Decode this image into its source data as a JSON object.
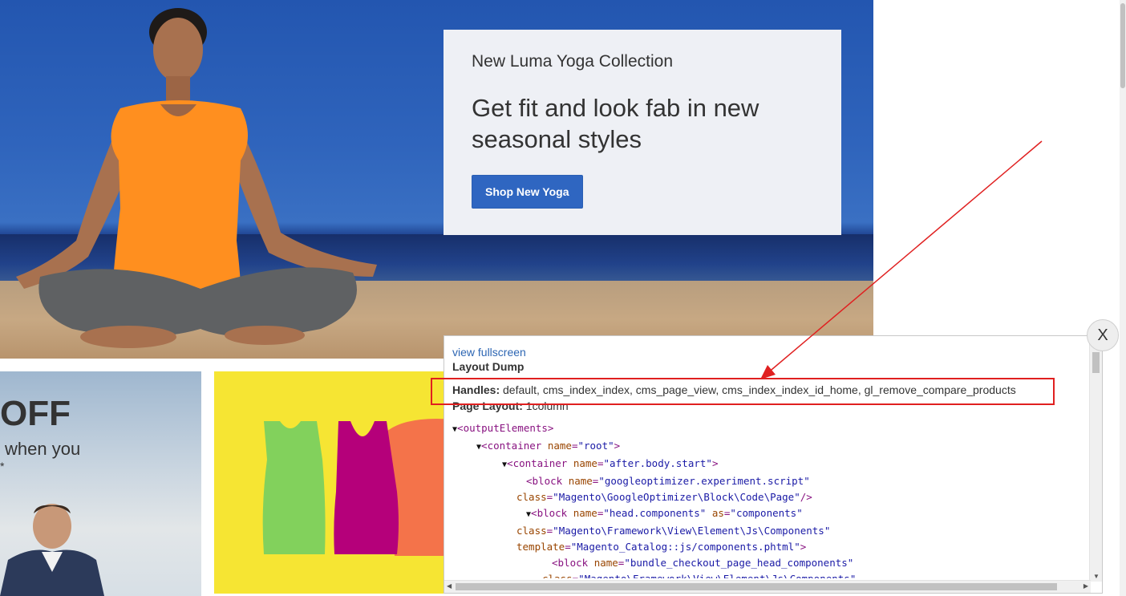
{
  "hero": {
    "kicker": "New Luma Yoga Collection",
    "title": "Get fit and look fab in new seasonal styles",
    "button_label": "Shop New Yoga"
  },
  "tiles": {
    "left_big": "OFF",
    "left_sub": "when you",
    "left_star": "*"
  },
  "dump": {
    "view_fullscreen": "view fullscreen",
    "title": "Layout Dump",
    "handles_label": "Handles:",
    "handles_value": "default, cms_index_index, cms_page_view, cms_index_index_id_home, gl_remove_compare_products",
    "page_layout_label": "Page Layout:",
    "page_layout_value": "1column",
    "code_lines": [
      {
        "tri": "▼",
        "parts": [
          [
            "p",
            "<"
          ],
          [
            "tag",
            "outputElements"
          ],
          [
            "p",
            ">"
          ]
        ]
      },
      {
        "tri": "▼",
        "parts": [
          [
            "p",
            "<"
          ],
          [
            "tag",
            "container "
          ],
          [
            "an",
            "name"
          ],
          [
            "p",
            "="
          ],
          [
            "av",
            "\"root\""
          ],
          [
            "p",
            ">"
          ]
        ]
      },
      {
        "tri": "▼",
        "parts": [
          [
            "p",
            "<"
          ],
          [
            "tag",
            "container "
          ],
          [
            "an",
            "name"
          ],
          [
            "p",
            "="
          ],
          [
            "av",
            "\"after.body.start\""
          ],
          [
            "p",
            ">"
          ]
        ]
      },
      {
        "tri": "",
        "parts": [
          [
            "p",
            "<"
          ],
          [
            "tag",
            "block "
          ],
          [
            "an",
            "name"
          ],
          [
            "p",
            "="
          ],
          [
            "av",
            "\"googleoptimizer.experiment.script\""
          ]
        ]
      },
      {
        "tri": "",
        "parts": [
          [
            "an",
            "class"
          ],
          [
            "p",
            "="
          ],
          [
            "av",
            "\"Magento\\GoogleOptimizer\\Block\\Code\\Page\""
          ],
          [
            "p",
            "/>"
          ]
        ]
      },
      {
        "tri": "▼",
        "parts": [
          [
            "p",
            "<"
          ],
          [
            "tag",
            "block "
          ],
          [
            "an",
            "name"
          ],
          [
            "p",
            "="
          ],
          [
            "av",
            "\"head.components\" "
          ],
          [
            "an",
            "as"
          ],
          [
            "p",
            "="
          ],
          [
            "av",
            "\"components\""
          ]
        ]
      },
      {
        "tri": "",
        "parts": [
          [
            "an",
            "class"
          ],
          [
            "p",
            "="
          ],
          [
            "av",
            "\"Magento\\Framework\\View\\Element\\Js\\Components\""
          ]
        ]
      },
      {
        "tri": "",
        "parts": [
          [
            "an",
            "template"
          ],
          [
            "p",
            "="
          ],
          [
            "av",
            "\"Magento_Catalog::js/components.phtml\""
          ],
          [
            "p",
            ">"
          ]
        ]
      },
      {
        "tri": "",
        "parts": [
          [
            "p",
            "<"
          ],
          [
            "tag",
            "block "
          ],
          [
            "an",
            "name"
          ],
          [
            "p",
            "="
          ],
          [
            "av",
            "\"bundle_checkout_page_head_components\""
          ]
        ]
      },
      {
        "tri": "",
        "parts": [
          [
            "an",
            "class"
          ],
          [
            "p",
            "="
          ],
          [
            "av",
            "\"Magento\\Framework\\View\\Element\\Js\\Components\""
          ]
        ]
      }
    ]
  },
  "close_label": "X",
  "colors": {
    "accent_button": "#2f66c1",
    "highlight": "#e02020",
    "link": "#2d66b3"
  }
}
